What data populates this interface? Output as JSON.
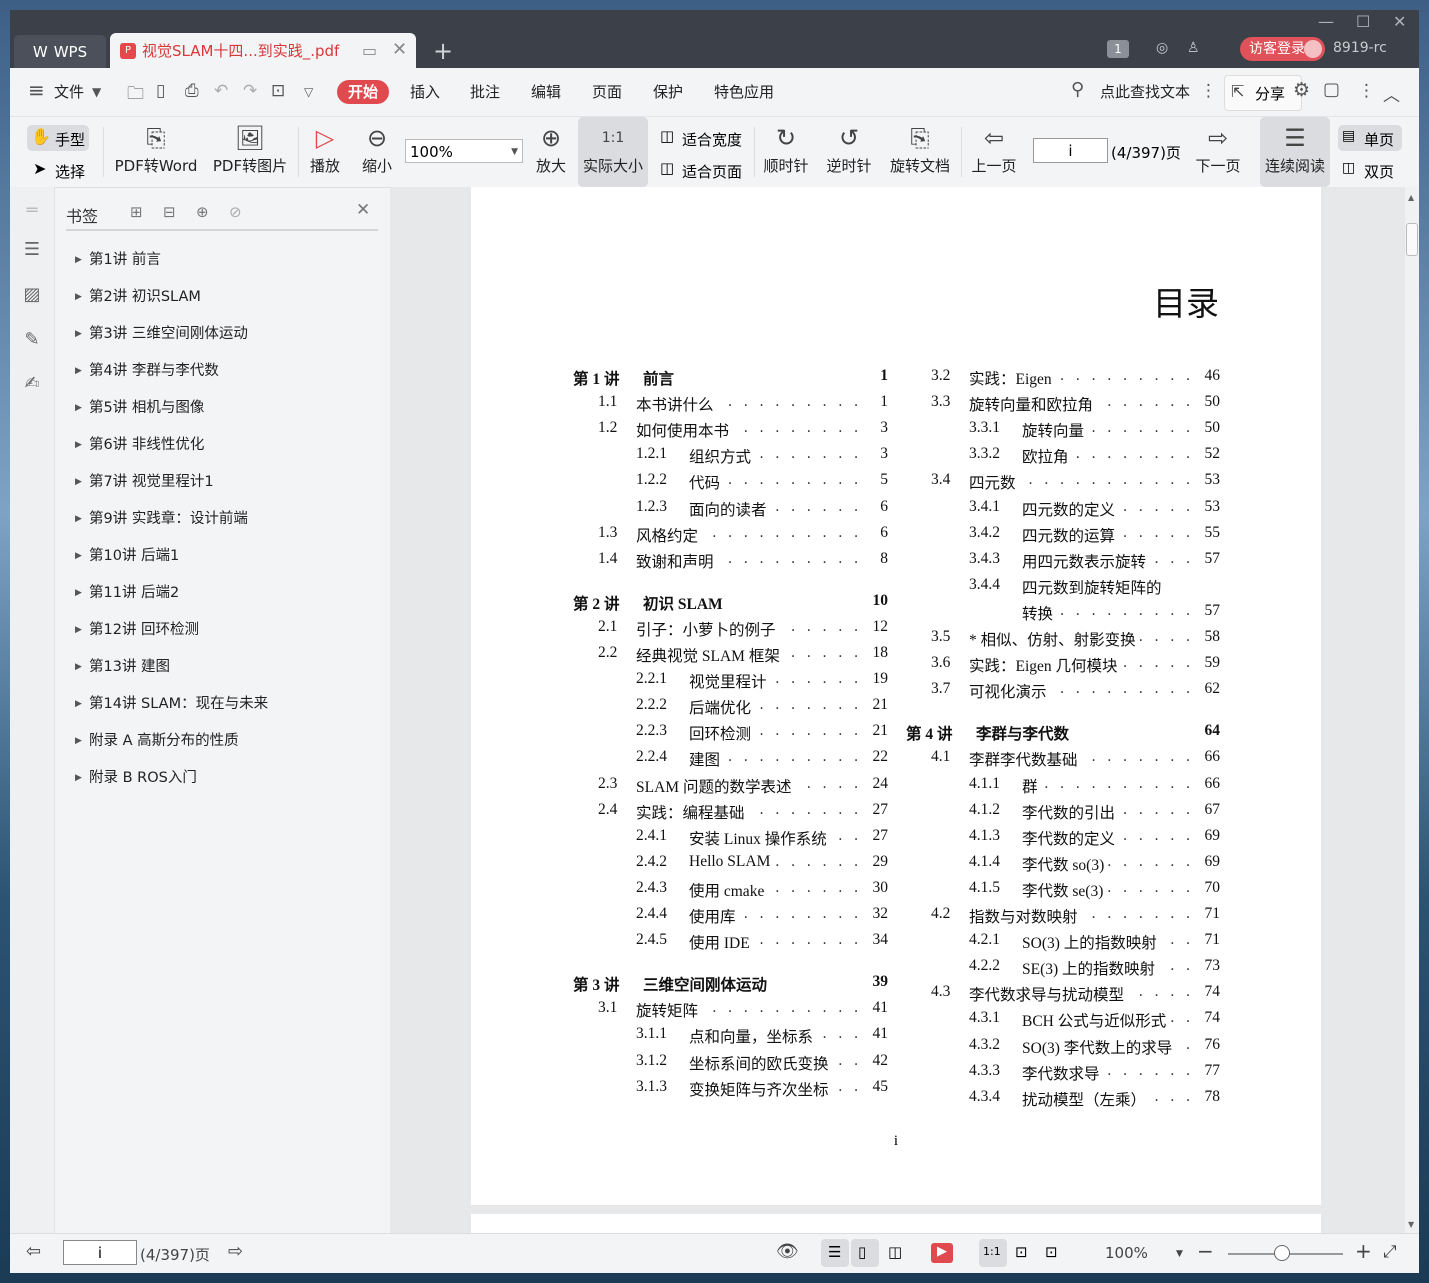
{
  "titlebar": {
    "app_tab": "WPS",
    "doc_tab": "视觉SLAM十四...到实践_.pdf",
    "badge": "1",
    "guest_login": "访客登录",
    "user_id": "8919-rc"
  },
  "menu": {
    "file": "文件",
    "items": [
      "开始",
      "插入",
      "批注",
      "编辑",
      "页面",
      "保护",
      "特色应用"
    ],
    "search": "点此查找文本",
    "share": "分享"
  },
  "toolbar": {
    "hand": "手型",
    "select": "选择",
    "pdf_to_word": "PDF转Word",
    "pdf_to_image": "PDF转图片",
    "play": "播放",
    "zoom_out": "缩小",
    "zoom_value": "100%",
    "zoom_in": "放大",
    "actual_size": "实际大小",
    "fit_width": "适合宽度",
    "fit_page": "适合页面",
    "clockwise": "顺时针",
    "counterclockwise": "逆时针",
    "rotate_doc": "旋转文档",
    "prev_page": "上一页",
    "page_input": "i",
    "page_count": "(4/397)页",
    "next_page": "下一页",
    "continuous": "连续阅读",
    "single": "单页",
    "double": "双页"
  },
  "bookmarks": {
    "title": "书签",
    "items": [
      "第1讲 前言",
      "第2讲 初识SLAM",
      "第3讲 三维空间刚体运动",
      "第4讲 李群与李代数",
      "第5讲 相机与图像",
      "第6讲 非线性优化",
      "第7讲 视觉里程计1",
      "第9讲 实践章：设计前端",
      "第10讲 后端1",
      "第11讲 后端2",
      "第12讲 回环检测",
      "第13讲 建图",
      "第14讲 SLAM：现在与未来",
      "附录 A 高斯分布的性质",
      "附录 B ROS入门"
    ]
  },
  "page": {
    "title": "目录",
    "page_number": "i",
    "left_column": [
      {
        "num": "第 1 讲",
        "text": "前言",
        "page": "1",
        "level": 0
      },
      {
        "num": "1.1",
        "text": "本书讲什么",
        "page": "1",
        "level": 1
      },
      {
        "num": "1.2",
        "text": "如何使用本书",
        "page": "3",
        "level": 1
      },
      {
        "num": "1.2.1",
        "text": "组织方式",
        "page": "3",
        "level": 2
      },
      {
        "num": "1.2.2",
        "text": "代码",
        "page": "5",
        "level": 2
      },
      {
        "num": "1.2.3",
        "text": "面向的读者",
        "page": "6",
        "level": 2
      },
      {
        "num": "1.3",
        "text": "风格约定",
        "page": "6",
        "level": 1
      },
      {
        "num": "1.4",
        "text": "致谢和声明",
        "page": "8",
        "level": 1
      },
      {
        "num": "第 2 讲",
        "text": "初识 SLAM",
        "page": "10",
        "level": 0
      },
      {
        "num": "2.1",
        "text": "引子：小萝卜的例子",
        "page": "12",
        "level": 1
      },
      {
        "num": "2.2",
        "text": "经典视觉 SLAM 框架",
        "page": "18",
        "level": 1
      },
      {
        "num": "2.2.1",
        "text": "视觉里程计",
        "page": "19",
        "level": 2
      },
      {
        "num": "2.2.2",
        "text": "后端优化",
        "page": "21",
        "level": 2
      },
      {
        "num": "2.2.3",
        "text": "回环检测",
        "page": "21",
        "level": 2
      },
      {
        "num": "2.2.4",
        "text": "建图",
        "page": "22",
        "level": 2
      },
      {
        "num": "2.3",
        "text": "SLAM 问题的数学表述",
        "page": "24",
        "level": 1
      },
      {
        "num": "2.4",
        "text": "实践：编程基础",
        "page": "27",
        "level": 1
      },
      {
        "num": "2.4.1",
        "text": "安装 Linux 操作系统",
        "page": "27",
        "level": 2
      },
      {
        "num": "2.4.2",
        "text": "Hello SLAM",
        "page": "29",
        "level": 2
      },
      {
        "num": "2.4.3",
        "text": "使用 cmake",
        "page": "30",
        "level": 2
      },
      {
        "num": "2.4.4",
        "text": "使用库",
        "page": "32",
        "level": 2
      },
      {
        "num": "2.4.5",
        "text": "使用 IDE",
        "page": "34",
        "level": 2
      },
      {
        "num": "第 3 讲",
        "text": "三维空间刚体运动",
        "page": "39",
        "level": 0
      },
      {
        "num": "3.1",
        "text": "旋转矩阵",
        "page": "41",
        "level": 1
      },
      {
        "num": "3.1.1",
        "text": "点和向量，坐标系",
        "page": "41",
        "level": 2
      },
      {
        "num": "3.1.2",
        "text": "坐标系间的欧氏变换",
        "page": "42",
        "level": 2
      },
      {
        "num": "3.1.3",
        "text": "变换矩阵与齐次坐标",
        "page": "45",
        "level": 2
      }
    ],
    "right_column": [
      {
        "num": "3.2",
        "text": "实践：Eigen",
        "page": "46",
        "level": 1
      },
      {
        "num": "3.3",
        "text": "旋转向量和欧拉角",
        "page": "50",
        "level": 1
      },
      {
        "num": "3.3.1",
        "text": "旋转向量",
        "page": "50",
        "level": 2
      },
      {
        "num": "3.3.2",
        "text": "欧拉角",
        "page": "52",
        "level": 2
      },
      {
        "num": "3.4",
        "text": "四元数",
        "page": "53",
        "level": 1
      },
      {
        "num": "3.4.1",
        "text": "四元数的定义",
        "page": "53",
        "level": 2
      },
      {
        "num": "3.4.2",
        "text": "四元数的运算",
        "page": "55",
        "level": 2
      },
      {
        "num": "3.4.3",
        "text": "用四元数表示旋转",
        "page": "57",
        "level": 2
      },
      {
        "num": "3.4.4",
        "text": "四元数到旋转矩阵的",
        "page": "",
        "level": 2
      },
      {
        "num": "",
        "text": "转换",
        "page": "57",
        "level": 2
      },
      {
        "num": "3.5",
        "text": "* 相似、仿射、射影变换",
        "page": "58",
        "level": 1
      },
      {
        "num": "3.6",
        "text": "实践：Eigen 几何模块",
        "page": "59",
        "level": 1
      },
      {
        "num": "3.7",
        "text": "可视化演示",
        "page": "62",
        "level": 1
      },
      {
        "num": "第 4 讲",
        "text": "李群与李代数",
        "page": "64",
        "level": 0
      },
      {
        "num": "4.1",
        "text": "李群李代数基础",
        "page": "66",
        "level": 1
      },
      {
        "num": "4.1.1",
        "text": "群",
        "page": "66",
        "level": 2
      },
      {
        "num": "4.1.2",
        "text": "李代数的引出",
        "page": "67",
        "level": 2
      },
      {
        "num": "4.1.3",
        "text": "李代数的定义",
        "page": "69",
        "level": 2
      },
      {
        "num": "4.1.4",
        "text": "李代数 so(3)",
        "page": "69",
        "level": 2
      },
      {
        "num": "4.1.5",
        "text": "李代数 se(3)",
        "page": "70",
        "level": 2
      },
      {
        "num": "4.2",
        "text": "指数与对数映射",
        "page": "71",
        "level": 1
      },
      {
        "num": "4.2.1",
        "text": "SO(3) 上的指数映射",
        "page": "71",
        "level": 2
      },
      {
        "num": "4.2.2",
        "text": "SE(3) 上的指数映射",
        "page": "73",
        "level": 2
      },
      {
        "num": "4.3",
        "text": "李代数求导与扰动模型",
        "page": "74",
        "level": 1
      },
      {
        "num": "4.3.1",
        "text": "BCH 公式与近似形式",
        "page": "74",
        "level": 2
      },
      {
        "num": "4.3.2",
        "text": "SO(3) 李代数上的求导",
        "page": "76",
        "level": 2
      },
      {
        "num": "4.3.3",
        "text": "李代数求导",
        "page": "77",
        "level": 2
      },
      {
        "num": "4.3.4",
        "text": "扰动模型（左乘）",
        "page": "78",
        "level": 2
      }
    ]
  },
  "statusbar": {
    "page_input": "i",
    "page_count": "(4/397)页",
    "zoom": "100%"
  }
}
